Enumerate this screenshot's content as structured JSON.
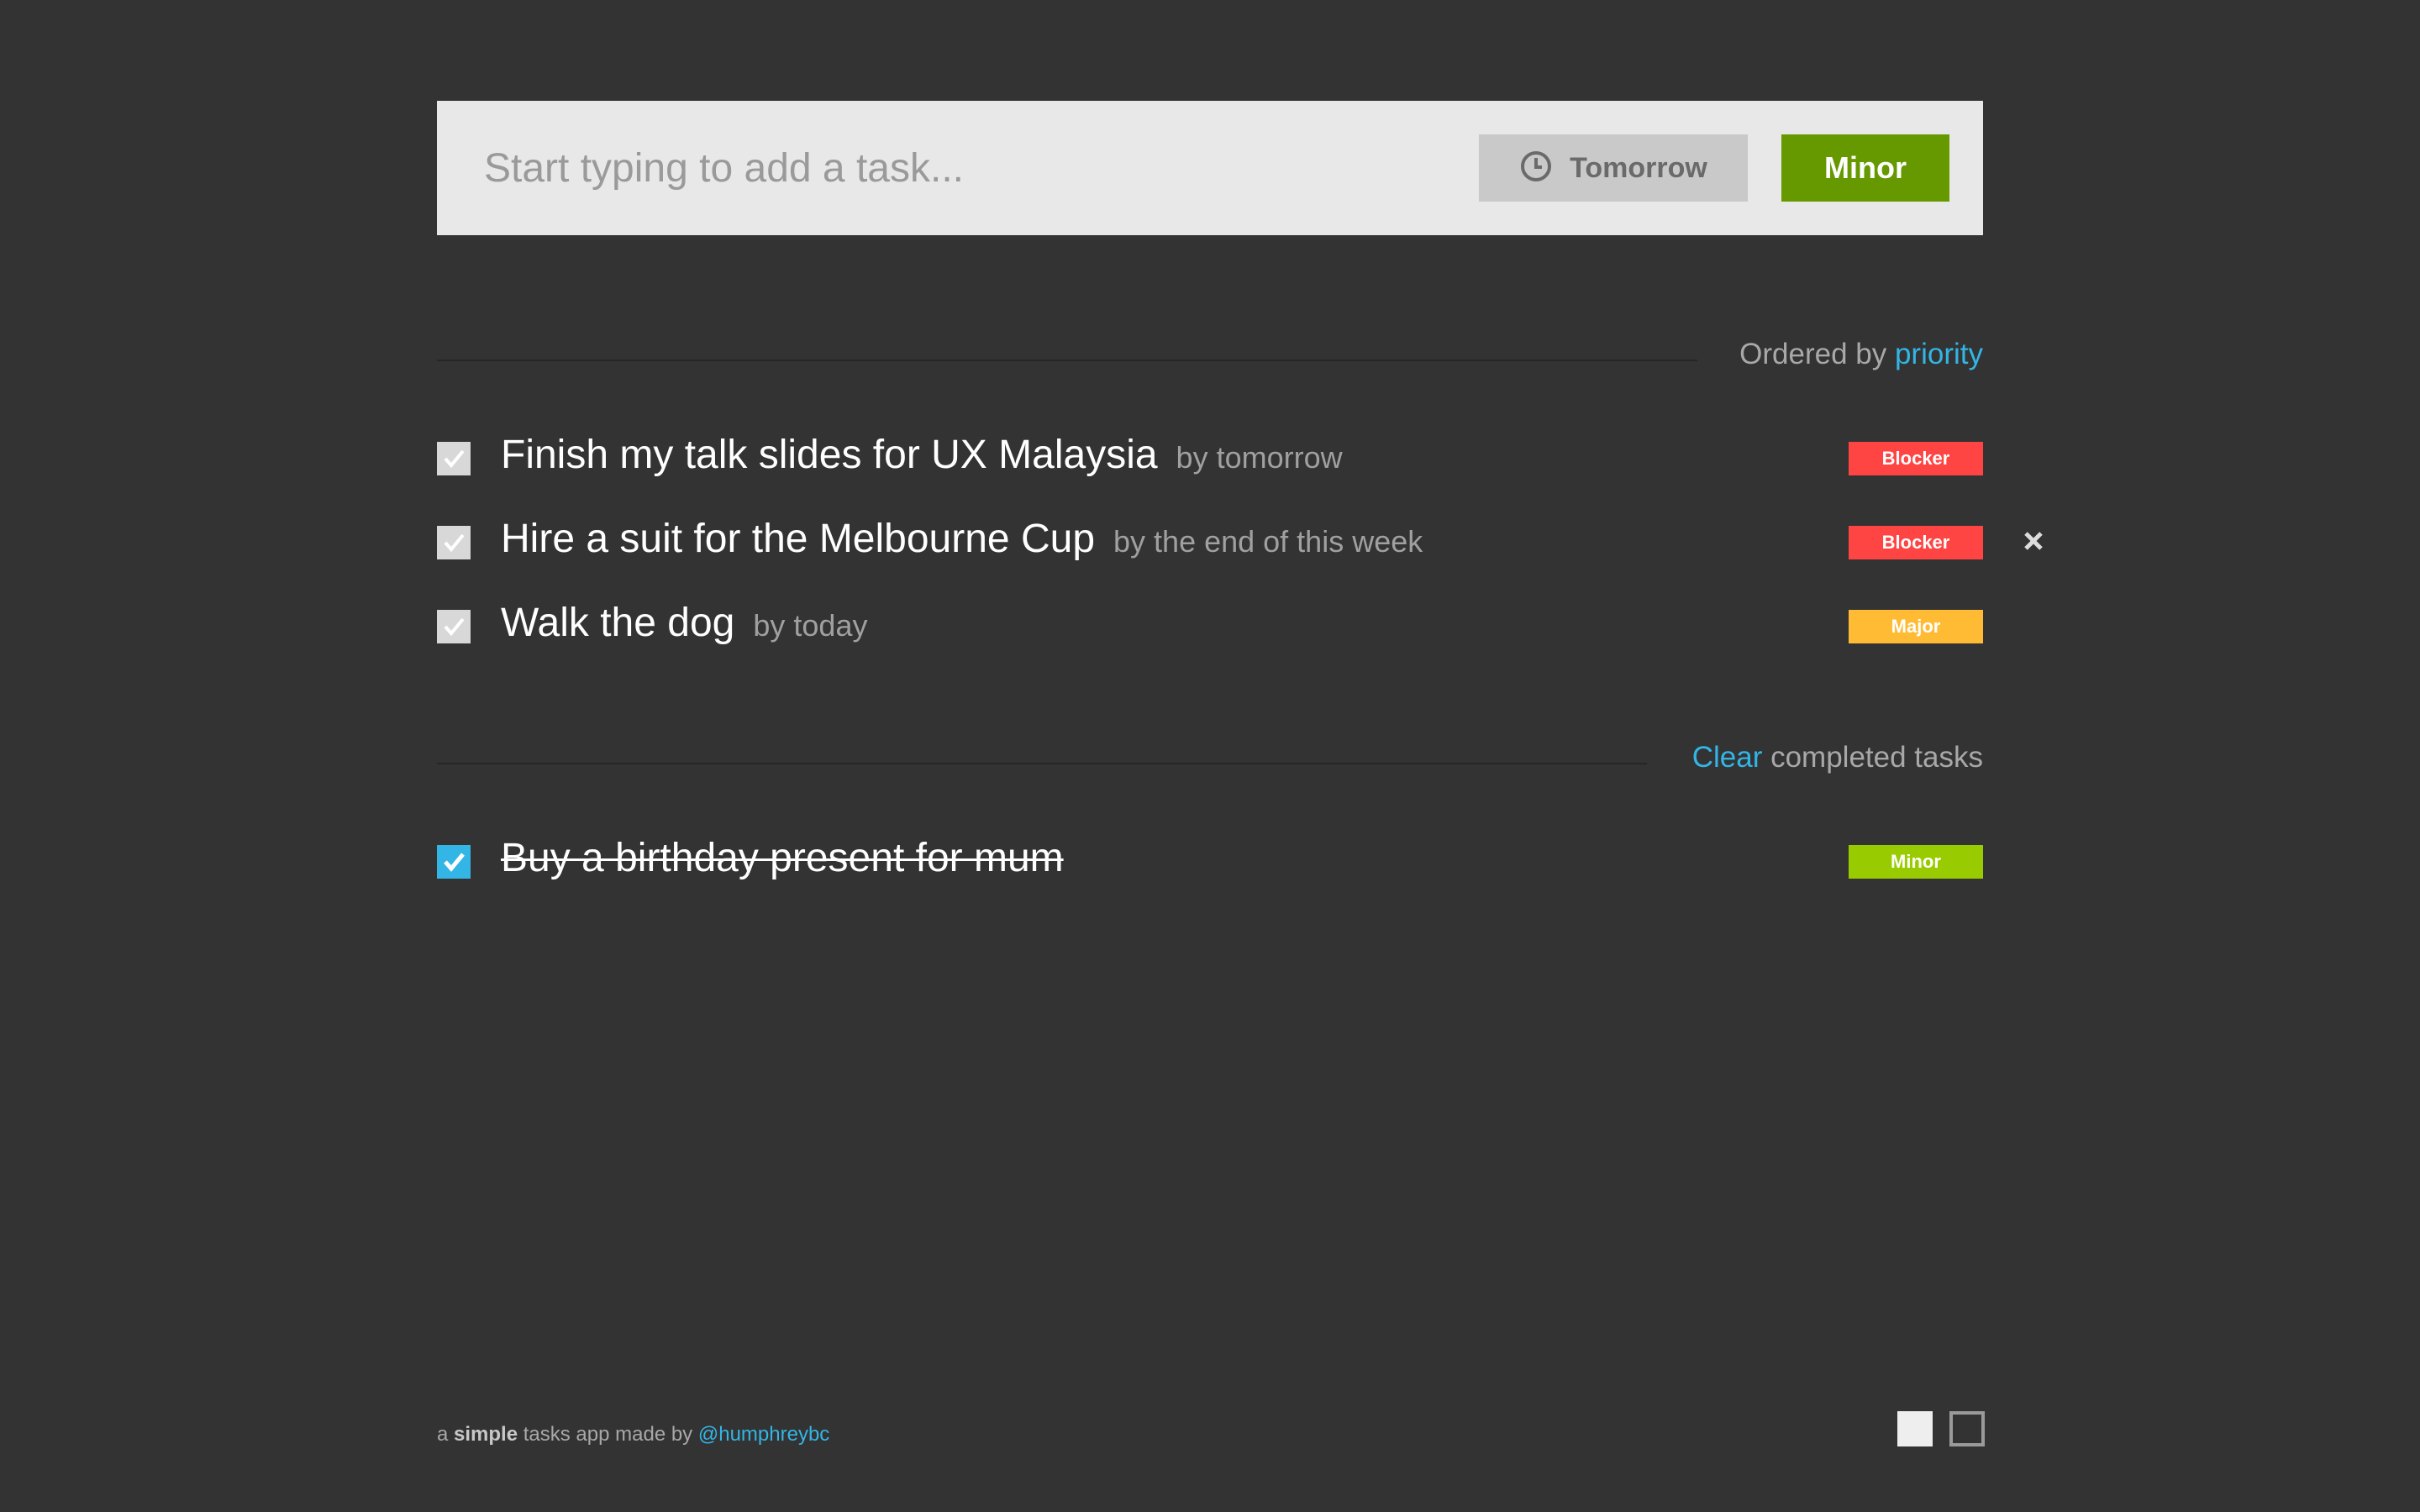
{
  "add_bar": {
    "placeholder": "Start typing to add a task...",
    "due_label": "Tomorrow",
    "due_icon": "clock-icon",
    "priority_label": "Minor"
  },
  "colors": {
    "background": "#333333",
    "blocker": "#ff4444",
    "major": "#ffbb33",
    "minor_badge": "#99cc00",
    "minor_button": "#669900",
    "accent": "#33b5e5"
  },
  "active_header": {
    "prefix": "Ordered by",
    "link": "priority"
  },
  "tasks": [
    {
      "title": "Finish my talk slides for UX Malaysia",
      "due": "by tomorrow",
      "priority": "Blocker",
      "checked": false
    },
    {
      "title": "Hire a suit for the Melbourne Cup",
      "due": "by the end of this week",
      "priority": "Blocker",
      "checked": false
    },
    {
      "title": "Walk the dog",
      "due": "by today",
      "priority": "Major",
      "checked": false
    }
  ],
  "completed_header": {
    "link": "Clear",
    "suffix": "completed tasks"
  },
  "completed_tasks": [
    {
      "title": "Buy a birthday present for mum",
      "priority": "Minor",
      "checked": true
    }
  ],
  "footer": {
    "pre": "a",
    "bold": "simple",
    "mid": "tasks app made by",
    "handle": "@humphreybc"
  }
}
